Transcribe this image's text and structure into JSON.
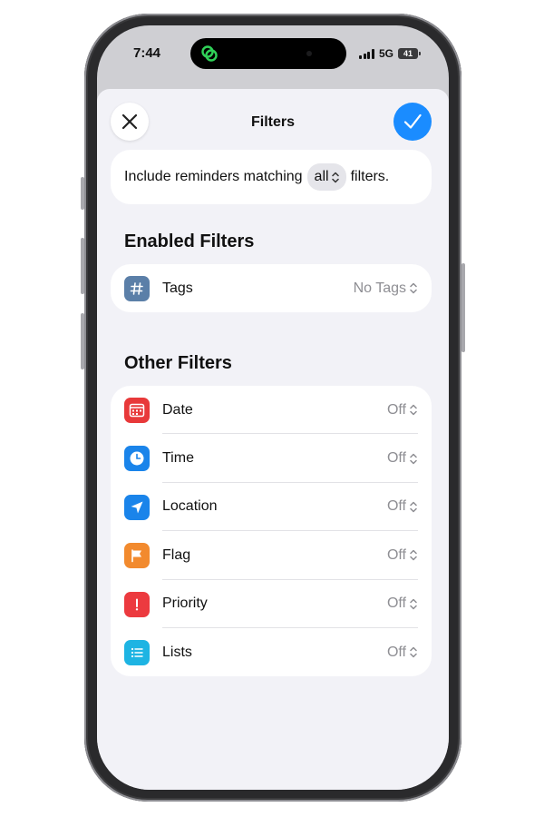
{
  "status_bar": {
    "time": "7:44",
    "network": "5G",
    "battery": "41"
  },
  "sheet": {
    "title": "Filters"
  },
  "match": {
    "prefix": "Include reminders matching",
    "value": "all",
    "suffix": "filters."
  },
  "enabled_section": {
    "heading": "Enabled Filters",
    "items": [
      {
        "label": "Tags",
        "value": "No Tags",
        "icon": "hashtag-icon",
        "color": "#5b7fa8"
      }
    ]
  },
  "other_section": {
    "heading": "Other Filters",
    "items": [
      {
        "label": "Date",
        "value": "Off",
        "icon": "calendar-icon",
        "color": "#e8393a"
      },
      {
        "label": "Time",
        "value": "Off",
        "icon": "clock-icon",
        "color": "#1a84ea"
      },
      {
        "label": "Location",
        "value": "Off",
        "icon": "location-arrow-icon",
        "color": "#1a84ea"
      },
      {
        "label": "Flag",
        "value": "Off",
        "icon": "flag-icon",
        "color": "#f28a2e"
      },
      {
        "label": "Priority",
        "value": "Off",
        "icon": "exclamation-icon",
        "color": "#ec3a3f"
      },
      {
        "label": "Lists",
        "value": "Off",
        "icon": "list-icon",
        "color": "#1eb4e3"
      }
    ]
  },
  "colors": {
    "accent": "#1a8cff",
    "sheet_bg": "#f2f2f7",
    "secondary_text": "#8e8e93"
  }
}
